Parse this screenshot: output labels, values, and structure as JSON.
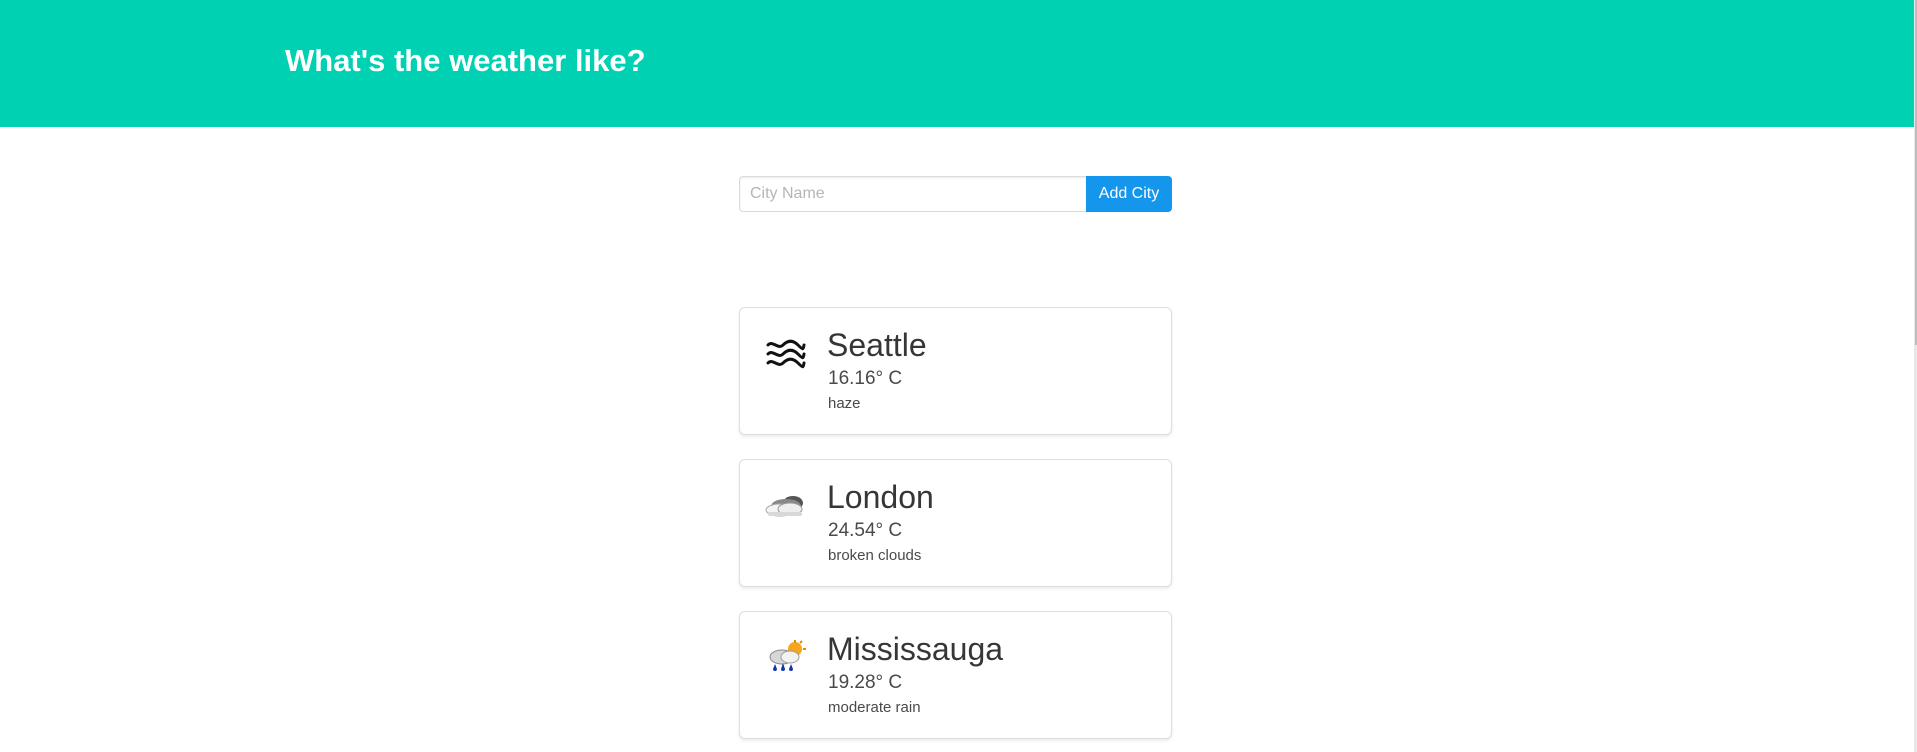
{
  "header": {
    "title": "What's the weather like?"
  },
  "search": {
    "placeholder": "City Name",
    "value": "",
    "button_label": "Add City"
  },
  "weather_cards": [
    {
      "city": "Seattle",
      "temperature": "16.16° C",
      "description": "haze",
      "icon": "haze-icon"
    },
    {
      "city": "London",
      "temperature": "24.54° C",
      "description": "broken clouds",
      "icon": "broken-clouds-icon"
    },
    {
      "city": "Mississauga",
      "temperature": "19.28° C",
      "description": "moderate rain",
      "icon": "moderate-rain-icon"
    }
  ],
  "colors": {
    "hero": "#00d1b2",
    "button": "#1496ed"
  }
}
